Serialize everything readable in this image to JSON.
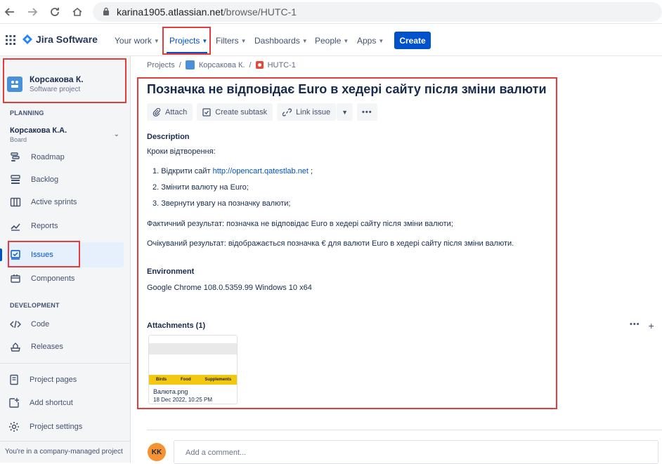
{
  "browser": {
    "url_host": "karina1905.atlassian.net",
    "url_path": "/browse/HUTC-1"
  },
  "topnav": {
    "product": "Jira Software",
    "menus": [
      {
        "label": "Your work"
      },
      {
        "label": "Projects"
      },
      {
        "label": "Filters"
      },
      {
        "label": "Dashboards"
      },
      {
        "label": "People"
      },
      {
        "label": "Apps"
      }
    ],
    "create_label": "Create"
  },
  "sidebar": {
    "project_name": "Корсакова К.",
    "project_type": "Software project",
    "planning_title": "PLANNING",
    "board_name": "Корсакова К.А.",
    "board_sub": "Board",
    "planning_items": [
      {
        "label": "Roadmap",
        "icon": "roadmap-icon"
      },
      {
        "label": "Backlog",
        "icon": "backlog-icon"
      },
      {
        "label": "Active sprints",
        "icon": "active-sprints-icon"
      },
      {
        "label": "Reports",
        "icon": "reports-icon"
      },
      {
        "label": "Issues",
        "icon": "issues-icon"
      },
      {
        "label": "Components",
        "icon": "components-icon"
      }
    ],
    "development_title": "DEVELOPMENT",
    "dev_items": [
      {
        "label": "Code",
        "icon": "code-icon"
      },
      {
        "label": "Releases",
        "icon": "releases-icon"
      }
    ],
    "bottom_items": [
      {
        "label": "Project pages",
        "icon": "project-pages-icon"
      },
      {
        "label": "Add shortcut",
        "icon": "add-shortcut-icon"
      },
      {
        "label": "Project settings",
        "icon": "gear-icon"
      }
    ],
    "company_note": "You're in a company-managed project"
  },
  "breadcrumbs": {
    "root": "Projects",
    "project": "Корсакова К.",
    "issue_key": "HUTC-1"
  },
  "issue": {
    "title": "Позначка не відповідає Euro в хедері сайту після зміни валюти",
    "actions": {
      "attach": "Attach",
      "create_subtask": "Create subtask",
      "link_issue": "Link issue"
    },
    "description_label": "Description",
    "steps_heading": "Кроки відтворення:",
    "step1_prefix": "1. Відкрити сайт ",
    "step1_link": "http://opencart.qatestlab.net",
    "step1_suffix": " ;",
    "step2": "2. Змінити валюту на Euro;",
    "step3": "3. Звернути увагу на позначку валюти;",
    "actual": "Фактичний результат: позначка не відповідає Euro в хедері сайту після зміни валюти;",
    "expected": "Очікуваний результат: відображається позначка € для валюти Euro в хедері сайту після зміни валюти.",
    "environment_label": "Environment",
    "environment": "Google Chrome 108.0.5359.99 Windows 10 x64",
    "attachments_label": "Attachments (1)",
    "attachment": {
      "name": "Валюта.png",
      "date": "18 Dec 2022, 10:25 PM",
      "thumb_nav": [
        "Birds",
        "Food",
        "Supplements"
      ]
    }
  },
  "comment": {
    "avatar_initials": "KK",
    "placeholder": "Add a comment..."
  },
  "colors": {
    "accent": "#0052cc",
    "annotation_red": "#e33d3d",
    "avatar_orange": "#f79232"
  }
}
